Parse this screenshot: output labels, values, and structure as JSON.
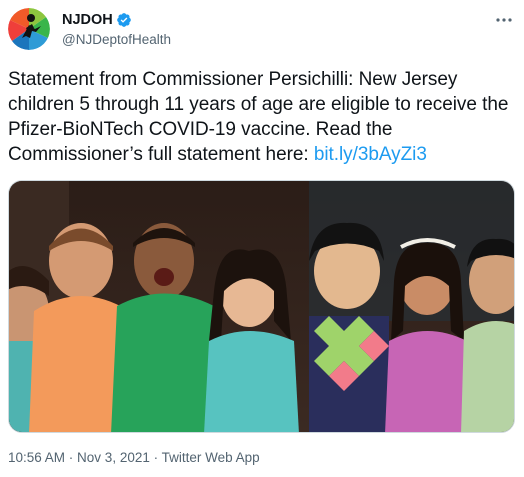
{
  "account": {
    "display_name": "NJDOH",
    "handle": "@NJDeptofHealth",
    "verified": true,
    "avatar_icon": "njdoh-logo-icon"
  },
  "menu": {
    "icon": "more-options-icon",
    "glyph": "···"
  },
  "tweet": {
    "text": "Statement from Commissioner Persichilli: New Jersey children 5 through 11 years of age are eligible to receive the Pfizer-BioNTech COVID-19 vaccine. Read the Commissioner’s full statement here: ",
    "link": "bit.ly/3bAyZi3"
  },
  "media": {
    "description_icon": "children-group-photo"
  },
  "meta": {
    "time": "10:56 AM",
    "separator1": " · ",
    "date": "Nov 3, 2021",
    "separator2": " · ",
    "source": "Twitter Web App"
  },
  "colors": {
    "link": "#1d9bf0",
    "verified_badge": "#1d9bf0",
    "text_primary": "#0f1419",
    "text_secondary": "#536471"
  }
}
